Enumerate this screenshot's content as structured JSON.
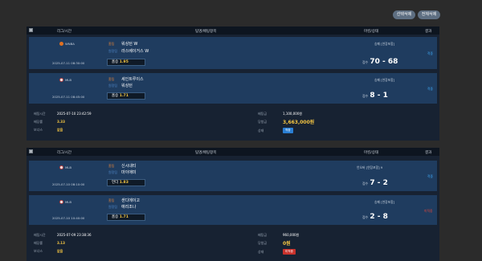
{
  "top_buttons": {
    "select_delete": "선택삭제",
    "delete_all": "전체삭제"
  },
  "table_header": {
    "league_time": "리그/시간",
    "match": "팀명/배팅항목",
    "match_status": "마킹/상태",
    "result": "결과"
  },
  "bet_slips": [
    {
      "rows": [
        {
          "sport_icon": "basketball-icon",
          "league": "WNBA",
          "datetime": "2025-07-11 08:30:00",
          "home_label": "홈팀",
          "home_team": "워싱턴 W",
          "away_label": "원정팀",
          "away_team": "라스베이거스 W",
          "pick_label": "홈승",
          "odds": "1.95",
          "status": "승패 [연장포함]",
          "score_label": "점수",
          "score": "70 - 68",
          "result": "적중",
          "result_color": "#3fa9f5"
        },
        {
          "sport_icon": "baseball-icon",
          "league": "MLB",
          "datetime": "2025-07-11 08:45:00",
          "home_label": "홈팀",
          "home_team": "세인트루이스",
          "away_label": "원정팀",
          "away_team": "워싱턴",
          "pick_label": "홈승",
          "odds": "1.71",
          "status": "승패 [연장포함]",
          "score_label": "점수",
          "score": "8 - 1",
          "result": "적중",
          "result_color": "#3fa9f5"
        }
      ],
      "summary": {
        "bet_time_label": "배팅시간",
        "bet_time": "2025-07-10 23:42:59",
        "odds_label": "배당률",
        "odds": "3.33",
        "bonus_label": "보너스",
        "bonus": "없음",
        "amount_label": "배팅금",
        "amount": "1,100,000원",
        "win_label": "당첨금",
        "win": "3,663,000원",
        "state_label": "상태",
        "state": "적중",
        "state_color": "#2a7fd4"
      }
    },
    {
      "rows": [
        {
          "sport_icon": "baseball-icon",
          "league": "MLB",
          "datetime": "2025-07-10 08:10:00",
          "home_label": "홈팀",
          "home_team": "신시내티",
          "away_label": "원정팀",
          "away_team": "마이애미",
          "pick_label": "언더",
          "odds": "1.83",
          "status": "언오버 [연장포함] 9",
          "score_label": "점수",
          "score": "7 - 2",
          "result": "적중",
          "result_color": "#3fa9f5"
        },
        {
          "sport_icon": "baseball-icon",
          "league": "MLB",
          "datetime": "2025-07-10 10:40:00",
          "home_label": "홈팀",
          "home_team": "샌디에이고",
          "away_label": "원정팀",
          "away_team": "애리조나",
          "pick_label": "홈승",
          "odds": "1.71",
          "status": "승패 [연장포함]",
          "score_label": "점수",
          "score": "2 - 8",
          "result": "미적중",
          "result_color": "#e0453a"
        }
      ],
      "summary": {
        "bet_time_label": "배팅시간",
        "bet_time": "2025-07-09 23:38:36",
        "odds_label": "배당률",
        "odds": "3.13",
        "bonus_label": "보너스",
        "bonus": "없음",
        "amount_label": "배팅금",
        "amount": "960,000원",
        "win_label": "당첨금",
        "win": "0원",
        "state_label": "상태",
        "state": "미적중",
        "state_color": "#c8322c"
      }
    }
  ]
}
